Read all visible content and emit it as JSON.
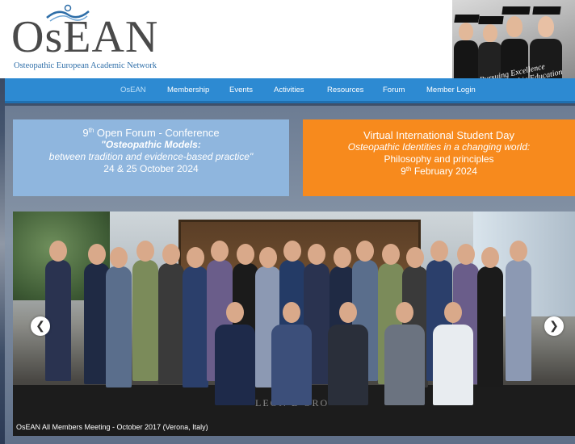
{
  "logo": {
    "wordmark": "OsEAN",
    "subtitle": "Osteopathic European Academic Network"
  },
  "header_image": {
    "tagline_line1": "Pursuing Excellence",
    "tagline_line2": "in Osteopathic Education"
  },
  "nav": {
    "items": [
      {
        "label": "OsEAN",
        "active": true
      },
      {
        "label": "Membership",
        "active": false
      },
      {
        "label": "Events",
        "active": false
      },
      {
        "label": "Activities",
        "active": false
      },
      {
        "label": "Resources",
        "active": false
      },
      {
        "label": "Forum",
        "active": false
      },
      {
        "label": "Member Login",
        "active": false
      }
    ]
  },
  "banner_left": {
    "num": "9",
    "sup": "th",
    "title_rest": " Open Forum - Conference",
    "line2": "\"Osteopathic Models:",
    "line3": "between tradition and evidence-based practice\"",
    "line4": "24 & 25 October 2024",
    "color": "#8fb6de"
  },
  "banner_right": {
    "title": "Virtual International Student Day",
    "line2": "Osteopathic Identities in a changing world:",
    "line3": "Philosophy and principles",
    "date_num": "9",
    "date_sup": "th",
    "date_rest": " February 2024",
    "color": "#f78a1d"
  },
  "slider": {
    "prev_icon": "chevron-left-icon",
    "next_icon": "chevron-right-icon",
    "prev_glyph": "❮",
    "next_glyph": "❯",
    "caption": "OsEAN All Members Meeting - October 2017 (Verona, Italy)",
    "carpet_text": "LEON D'ORO"
  },
  "colors": {
    "nav": "#2d8ad2",
    "logo_blue": "#2e6ea8"
  }
}
